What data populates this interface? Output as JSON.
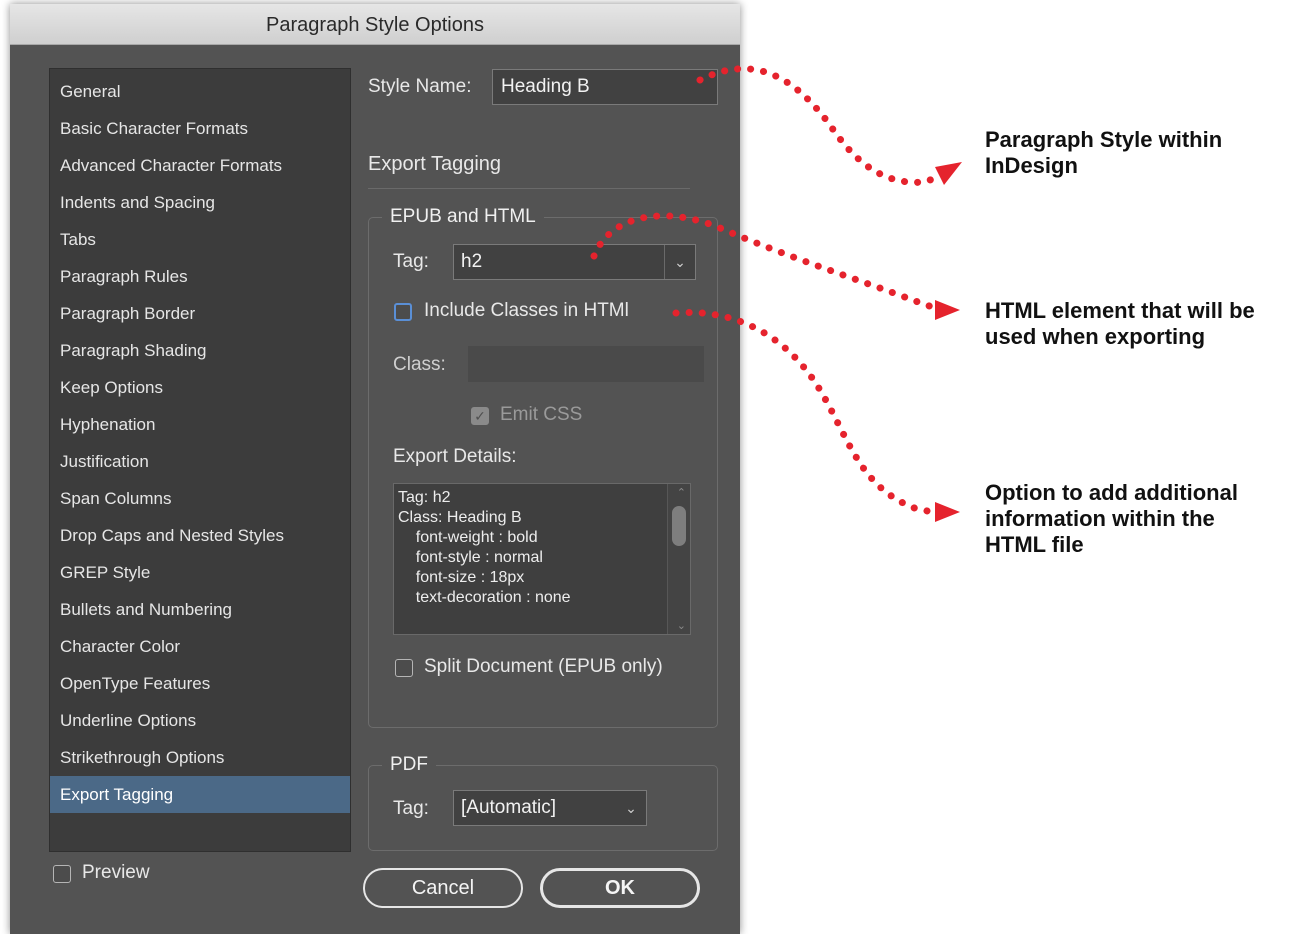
{
  "dialog": {
    "title": "Paragraph Style Options",
    "style_name_label": "Style Name:",
    "style_name_value": "Heading B",
    "section_heading": "Export Tagging"
  },
  "sidebar": {
    "items": [
      {
        "label": "General"
      },
      {
        "label": "Basic Character Formats"
      },
      {
        "label": "Advanced Character Formats"
      },
      {
        "label": "Indents and Spacing"
      },
      {
        "label": "Tabs"
      },
      {
        "label": "Paragraph Rules"
      },
      {
        "label": "Paragraph Border"
      },
      {
        "label": "Paragraph Shading"
      },
      {
        "label": "Keep Options"
      },
      {
        "label": "Hyphenation"
      },
      {
        "label": "Justification"
      },
      {
        "label": "Span Columns"
      },
      {
        "label": "Drop Caps and Nested Styles"
      },
      {
        "label": "GREP Style"
      },
      {
        "label": "Bullets and Numbering"
      },
      {
        "label": "Character Color"
      },
      {
        "label": "OpenType Features"
      },
      {
        "label": "Underline Options"
      },
      {
        "label": "Strikethrough Options"
      },
      {
        "label": "Export Tagging"
      }
    ],
    "selected": "Export Tagging"
  },
  "epub": {
    "group_title": "EPUB and HTML",
    "tag_label": "Tag:",
    "tag_value": "h2",
    "include_classes_label": "Include Classes in HTMl",
    "include_classes_checked": false,
    "class_label": "Class:",
    "class_value": "",
    "emit_css_label": "Emit CSS",
    "emit_css_checked": true,
    "export_details_label": "Export Details:",
    "export_details_lines": [
      "Tag: h2",
      "Class: Heading B",
      "    font-weight : bold",
      "    font-style : normal",
      "    font-size : 18px",
      "    text-decoration : none"
    ],
    "split_document_label": "Split Document (EPUB only)",
    "split_document_checked": false
  },
  "pdf": {
    "group_title": "PDF",
    "tag_label": "Tag:",
    "tag_value": "[Automatic]"
  },
  "footer": {
    "preview_label": "Preview",
    "preview_checked": false,
    "cancel_label": "Cancel",
    "ok_label": "OK"
  },
  "annotations": {
    "style_note": [
      "Paragraph Style within",
      "InDesign"
    ],
    "tag_note": [
      "HTML element that will be",
      "used when exporting"
    ],
    "class_note": [
      "Option to add additional",
      "information within the",
      "HTML file"
    ],
    "arrow_color": "#e5232d"
  },
  "icons": {
    "dropdown": "chevron-down-icon",
    "checkmark": "checkmark-icon",
    "scroll_up": "scroll-up-icon",
    "scroll_down": "scroll-down-icon"
  }
}
